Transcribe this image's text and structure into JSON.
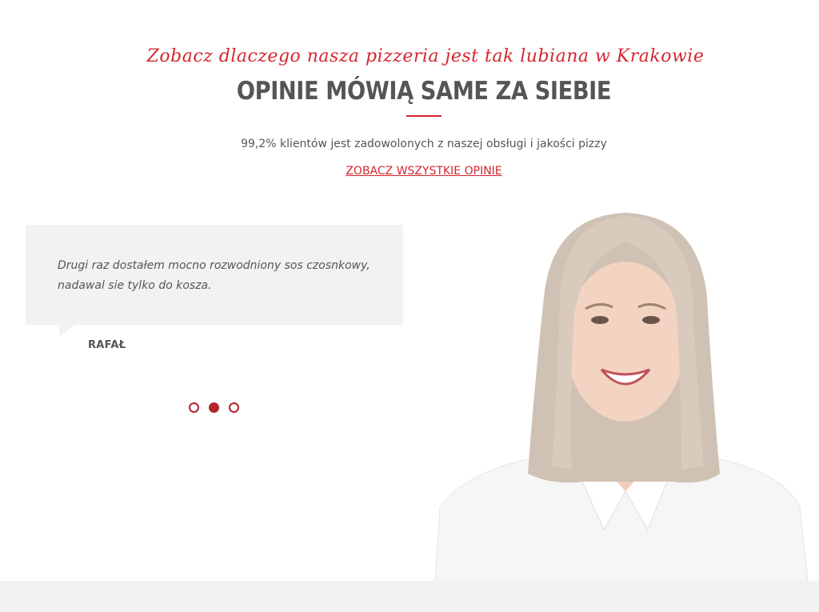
{
  "header": {
    "script_title": "Zobacz dlaczego nasza pizzeria jest tak lubiana w Krakowie",
    "main_title": "OPINIE MÓWIĄ SAME ZA SIEBIE",
    "subtitle": "99,2% klientów jest zadowolonych z naszej obsługi i jakości pizzy",
    "all_reviews_link": "ZOBACZ WSZYSTKIE OPINIE"
  },
  "testimonial": {
    "quote": "Drugi raz dostałem mocno rozwodniony sos czosnkowy, nadawal sie tylko do kosza.",
    "author": "RAFAŁ"
  },
  "slider": {
    "dot_count": 3,
    "active_index": 1
  },
  "colors": {
    "accent": "#d3272f",
    "text": "#555555",
    "quote_bg": "#f2f2f2"
  }
}
